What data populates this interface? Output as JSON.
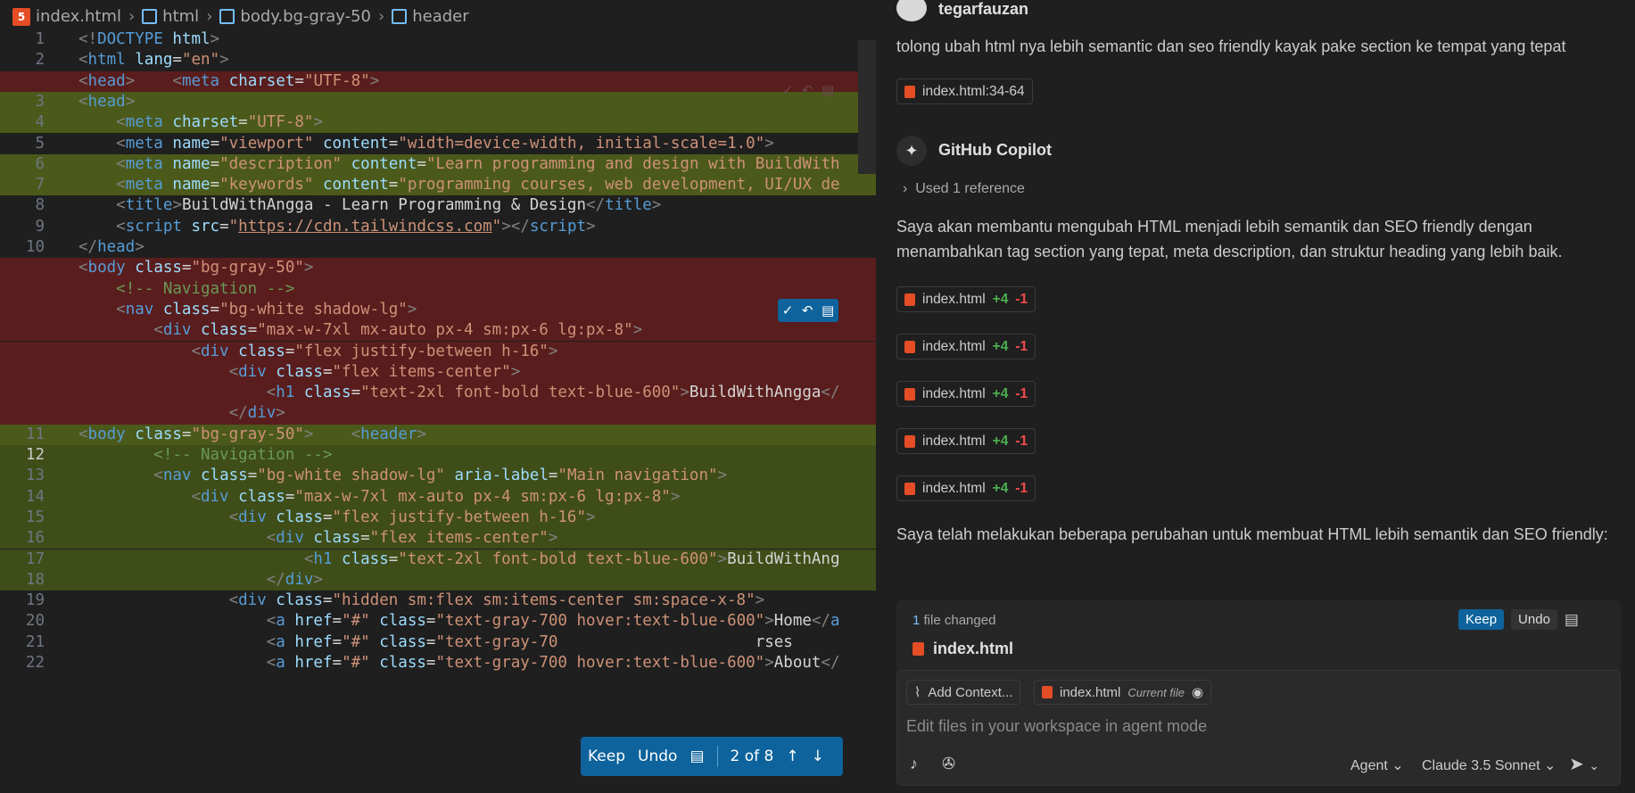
{
  "breadcrumb": [
    "index.html",
    "html",
    "body.bg-gray-50",
    "header"
  ],
  "editor": {
    "lines": [
      {
        "num": "1",
        "bg": "",
        "html": "<span class='p'>&lt;!</span><span class='t'>DOCTYPE</span> <span class='a'>html</span><span class='p'>&gt;</span>"
      },
      {
        "num": "2",
        "bg": "",
        "html": "<span class='p'>&lt;</span><span class='t'>html</span> <span class='a'>lang</span>=<span class='s'>\"en\"</span><span class='p'>&gt;</span>"
      },
      {
        "num": "",
        "bg": "red",
        "html": "<span class='p'>&lt;</span><span class='t'>head</span><span class='p'>&gt;</span>    <span class='p'>&lt;</span><span class='t'>meta</span> <span class='a'>charset</span>=<span class='s'>\"UTF-8\"</span><span class='p'>&gt;</span>"
      },
      {
        "num": "3",
        "bg": "green",
        "html": "<span class='p'>&lt;</span><span class='t'>head</span><span class='p'>&gt;</span>"
      },
      {
        "num": "4",
        "bg": "green",
        "html": "    <span class='p'>&lt;</span><span class='t'>meta</span> <span class='a'>charset</span>=<span class='s'>\"UTF-8\"</span><span class='p'>&gt;</span>"
      },
      {
        "num": "5",
        "bg": "",
        "html": "    <span class='p'>&lt;</span><span class='t'>meta</span> <span class='a'>name</span>=<span class='s'>\"viewport\"</span> <span class='a'>content</span>=<span class='s'>\"width=device-width, initial-scale=1.0\"</span><span class='p'>&gt;</span>"
      },
      {
        "num": "6",
        "bg": "green",
        "html": "    <span class='p'>&lt;</span><span class='t'>meta</span> <span class='a'>name</span>=<span class='s'>\"description\"</span> <span class='a'>content</span>=<span class='s'>\"Learn programming and design with BuildWith</span>"
      },
      {
        "num": "7",
        "bg": "green",
        "html": "    <span class='p'>&lt;</span><span class='t'>meta</span> <span class='a'>name</span>=<span class='s'>\"keywords\"</span> <span class='a'>content</span>=<span class='s'>\"programming courses, web development, UI/UX de</span>"
      },
      {
        "num": "8",
        "bg": "",
        "html": "    <span class='p'>&lt;</span><span class='t'>title</span><span class='p'>&gt;</span><span class='w'>BuildWithAngga - Learn Programming &amp; Design</span><span class='p'>&lt;/</span><span class='t'>title</span><span class='p'>&gt;</span>"
      },
      {
        "num": "9",
        "bg": "",
        "html": "    <span class='p'>&lt;</span><span class='t'>script</span> <span class='a'>src</span>=<span class='s'>\"<span class='u'>https://cdn.tailwindcss.com</span>\"</span><span class='p'>&gt;&lt;/</span><span class='t'>script</span><span class='p'>&gt;</span>"
      },
      {
        "num": "10",
        "bg": "",
        "html": "<span class='p'>&lt;/</span><span class='t'>head</span><span class='p'>&gt;</span>"
      },
      {
        "num": "",
        "bg": "red",
        "html": "<span class='p'>&lt;</span><span class='t'>body</span> <span class='a'>class</span>=<span class='s'>\"bg-gray-50\"</span><span class='p'>&gt;</span>"
      },
      {
        "num": "",
        "bg": "red",
        "html": "    <span class='c'>&lt;!-- Navigation --&gt;</span>"
      },
      {
        "num": "",
        "bg": "red",
        "html": "    <span class='p'>&lt;</span><span class='t'>nav</span> <span class='a'>class</span>=<span class='s'>\"bg-white shadow-lg\"</span><span class='p'>&gt;</span>"
      },
      {
        "num": "",
        "bg": "red",
        "html": "        <span class='p'>&lt;</span><span class='t'>div</span> <span class='a'>class</span>=<span class='s'>\"max-w-7xl mx-auto px-4 sm:px-6 lg:px-8\"</span><span class='p'>&gt;</span>"
      },
      {
        "num": "",
        "bg": "red",
        "html": "            <span class='p'>&lt;</span><span class='t'>div</span> <span class='a'>class</span>=<span class='s'>\"flex justify-between h-16\"</span><span class='p'>&gt;</span>"
      },
      {
        "num": "",
        "bg": "red",
        "html": "                <span class='p'>&lt;</span><span class='t'>div</span> <span class='a'>class</span>=<span class='s'>\"flex items-center\"</span><span class='p'>&gt;</span>"
      },
      {
        "num": "",
        "bg": "red",
        "html": "                    <span class='p'>&lt;</span><span class='t'>h1</span> <span class='a'>class</span>=<span class='s'>\"text-2xl font-bold text-blue-600\"</span><span class='p'>&gt;</span><span class='w'>BuildWithAngga</span><span class='p'>&lt;/</span>"
      },
      {
        "num": "",
        "bg": "red",
        "html": "                <span class='p'>&lt;/</span><span class='t'>div</span><span class='p'>&gt;</span>"
      },
      {
        "num": "11",
        "bg": "green",
        "html": "<span class='p'>&lt;</span><span class='t'>body</span> <span class='a'>class</span>=<span class='s'>\"bg-gray-50\"</span><span class='p'>&gt;</span>    <span class='p'>&lt;</span><span class='t'>header</span><span class='p'>&gt;</span>"
      },
      {
        "num": "12",
        "bg": "green2",
        "cur": true,
        "html": "        <span class='c'>&lt;!-- Navigation --&gt;</span>"
      },
      {
        "num": "13",
        "bg": "green2",
        "html": "        <span class='p'>&lt;</span><span class='t'>nav</span> <span class='a'>class</span>=<span class='s'>\"bg-white shadow-lg\"</span> <span class='a'>aria-label</span>=<span class='s'>\"Main navigation\"</span><span class='p'>&gt;</span>"
      },
      {
        "num": "14",
        "bg": "green2",
        "html": "            <span class='p'>&lt;</span><span class='t'>div</span> <span class='a'>class</span>=<span class='s'>\"max-w-7xl mx-auto px-4 sm:px-6 lg:px-8\"</span><span class='p'>&gt;</span>"
      },
      {
        "num": "15",
        "bg": "green2",
        "html": "                <span class='p'>&lt;</span><span class='t'>div</span> <span class='a'>class</span>=<span class='s'>\"flex justify-between h-16\"</span><span class='p'>&gt;</span>"
      },
      {
        "num": "16",
        "bg": "green2",
        "html": "                    <span class='p'>&lt;</span><span class='t'>div</span> <span class='a'>class</span>=<span class='s'>\"flex items-center\"</span><span class='p'>&gt;</span>"
      },
      {
        "num": "17",
        "bg": "green2",
        "html": "                        <span class='p'>&lt;</span><span class='t'>h1</span> <span class='a'>class</span>=<span class='s'>\"text-2xl font-bold text-blue-600\"</span><span class='p'>&gt;</span><span class='w'>BuildWithAng</span>"
      },
      {
        "num": "18",
        "bg": "green2",
        "html": "                    <span class='p'>&lt;/</span><span class='t'>div</span><span class='p'>&gt;</span>"
      },
      {
        "num": "19",
        "bg": "",
        "html": "                <span class='p'>&lt;</span><span class='t'>div</span> <span class='a'>class</span>=<span class='s'>\"hidden sm:flex sm:items-center sm:space-x-8\"</span><span class='p'>&gt;</span>"
      },
      {
        "num": "20",
        "bg": "",
        "html": "                    <span class='p'>&lt;</span><span class='t'>a</span> <span class='a'>href</span>=<span class='s'>\"#\"</span> <span class='a'>class</span>=<span class='s'>\"text-gray-700 hover:text-blue-600\"</span><span class='p'>&gt;</span><span class='w'>Home</span><span class='p'>&lt;/</span><span class='t'>a</span>"
      },
      {
        "num": "21",
        "bg": "",
        "html": "                    <span class='p'>&lt;</span><span class='t'>a</span> <span class='a'>href</span>=<span class='s'>\"#\"</span> <span class='a'>class</span>=<span class='s'>\"text-gray-70</span>                     <span class='w'>rses</span>"
      },
      {
        "num": "22",
        "bg": "",
        "html": "                    <span class='p'>&lt;</span><span class='t'>a</span> <span class='a'>href</span>=<span class='s'>\"#\"</span> <span class='a'>class</span>=<span class='s'>\"text-gray-700 hover:text-blue-600\"</span><span class='p'>&gt;</span><span class='w'>About</span><span class='p'>&lt;/</span>"
      }
    ],
    "review_bar": {
      "keep": "Keep",
      "undo": "Undo",
      "position": "2 of 8"
    }
  },
  "chat": {
    "user": {
      "name": "tegarfauzan",
      "message": "tolong ubah html nya lebih semantic dan seo friendly kayak pake section ke tempat yang tepat",
      "ref": "index.html:34-64"
    },
    "assistant": {
      "name": "GitHub Copilot",
      "used_ref": "Used 1 reference",
      "intro": "Saya akan membantu mengubah HTML menjadi lebih semantik dan SEO friendly dengan menambahkan tag section yang tepat, meta description, dan struktur heading yang lebih baik.",
      "edits": [
        {
          "file": "index.html",
          "plus": "+4",
          "minus": "-1"
        },
        {
          "file": "index.html",
          "plus": "+4",
          "minus": "-1"
        },
        {
          "file": "index.html",
          "plus": "+4",
          "minus": "-1"
        },
        {
          "file": "index.html",
          "plus": "+4",
          "minus": "-1"
        },
        {
          "file": "index.html",
          "plus": "+4",
          "minus": "-1"
        }
      ],
      "summary": "Saya telah melakukan beberapa perubahan untuk membuat HTML lebih semantik dan SEO friendly:"
    },
    "changes": {
      "count_num": "1",
      "count_text": "file changed",
      "keep": "Keep",
      "undo": "Undo",
      "file": "index.html"
    },
    "input": {
      "add_context": "Add Context...",
      "current_file": "index.html",
      "current_file_label": "Current file",
      "placeholder": "Edit files in your workspace in agent mode",
      "mode": "Agent",
      "model": "Claude 3.5 Sonnet"
    }
  }
}
